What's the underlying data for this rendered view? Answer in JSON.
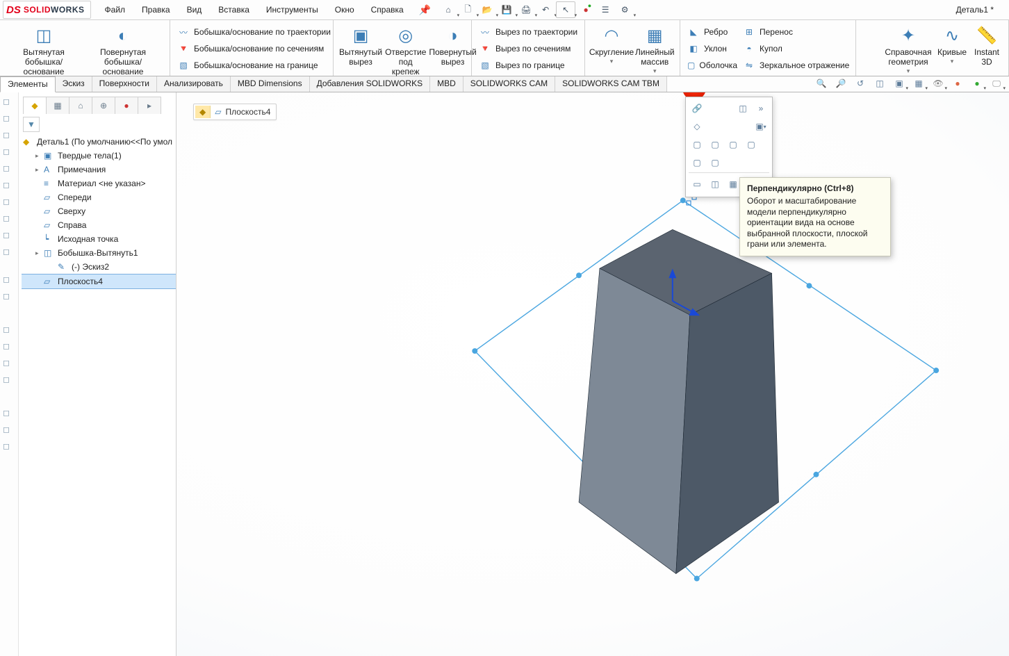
{
  "menubar": {
    "items": [
      "Файл",
      "Правка",
      "Вид",
      "Вставка",
      "Инструменты",
      "Окно",
      "Справка"
    ]
  },
  "doc_title": "Деталь1 *",
  "breadcrumb": "Плоскость4",
  "ribbon": {
    "features": [
      {
        "label": "Вытянутая бобышка/основание"
      },
      {
        "label": "Повернутая бобышка/основание"
      }
    ],
    "boss_list": [
      "Бобышка/основание по траектории",
      "Бобышка/основание по сечениям",
      "Бобышка/основание на границе"
    ],
    "cuts": [
      {
        "label": "Вытянутый вырез"
      },
      {
        "label": "Отверстие под крепеж"
      },
      {
        "label": "Повернутый вырез"
      }
    ],
    "cut_list": [
      "Вырез по траектории",
      "Вырез по сечениям",
      "Вырез по границе"
    ],
    "feat2": [
      {
        "label": "Скругление"
      },
      {
        "label": "Линейный массив"
      }
    ],
    "col1": [
      "Ребро",
      "Уклон",
      "Оболочка"
    ],
    "col2": [
      "Перенос",
      "Купол",
      "Зеркальное отражение"
    ],
    "right": [
      {
        "label": "Справочная геометрия"
      },
      {
        "label": "Кривые"
      },
      {
        "label": "Instant 3D"
      }
    ]
  },
  "cm_tabs": [
    "Элементы",
    "Эскиз",
    "Поверхности",
    "Анализировать",
    "MBD Dimensions",
    "Добавления SOLIDWORKS",
    "MBD",
    "SOLIDWORKS CAM",
    "SOLIDWORKS CAM TBM"
  ],
  "tree": {
    "root": "Деталь1  (По умолчанию<<По умол",
    "items": [
      {
        "label": "Твердые тела(1)",
        "expander": "▸",
        "icon": "solid-bodies-icon"
      },
      {
        "label": "Примечания",
        "expander": "▸",
        "icon": "annotations-icon"
      },
      {
        "label": "Материал <не указан>",
        "expander": "",
        "icon": "material-icon"
      },
      {
        "label": "Спереди",
        "expander": "",
        "icon": "plane-icon"
      },
      {
        "label": "Сверху",
        "expander": "",
        "icon": "plane-icon"
      },
      {
        "label": "Справа",
        "expander": "",
        "icon": "plane-icon"
      },
      {
        "label": "Исходная точка",
        "expander": "",
        "icon": "origin-icon"
      },
      {
        "label": "Бобышка-Вытянуть1",
        "expander": "▸",
        "icon": "extrude-icon"
      },
      {
        "label": "(-) Эскиз2",
        "expander": "",
        "icon": "sketch-icon",
        "indent": 40
      },
      {
        "label": "Плоскость4",
        "expander": "",
        "icon": "plane-icon",
        "selected": true
      }
    ]
  },
  "tooltip": {
    "title": "Перпендикулярно   (Ctrl+8)",
    "body": "Оборот и масштабирование модели перпендикулярно ориентации вида на основе выбранной плоскости, плоской грани или элемента."
  }
}
